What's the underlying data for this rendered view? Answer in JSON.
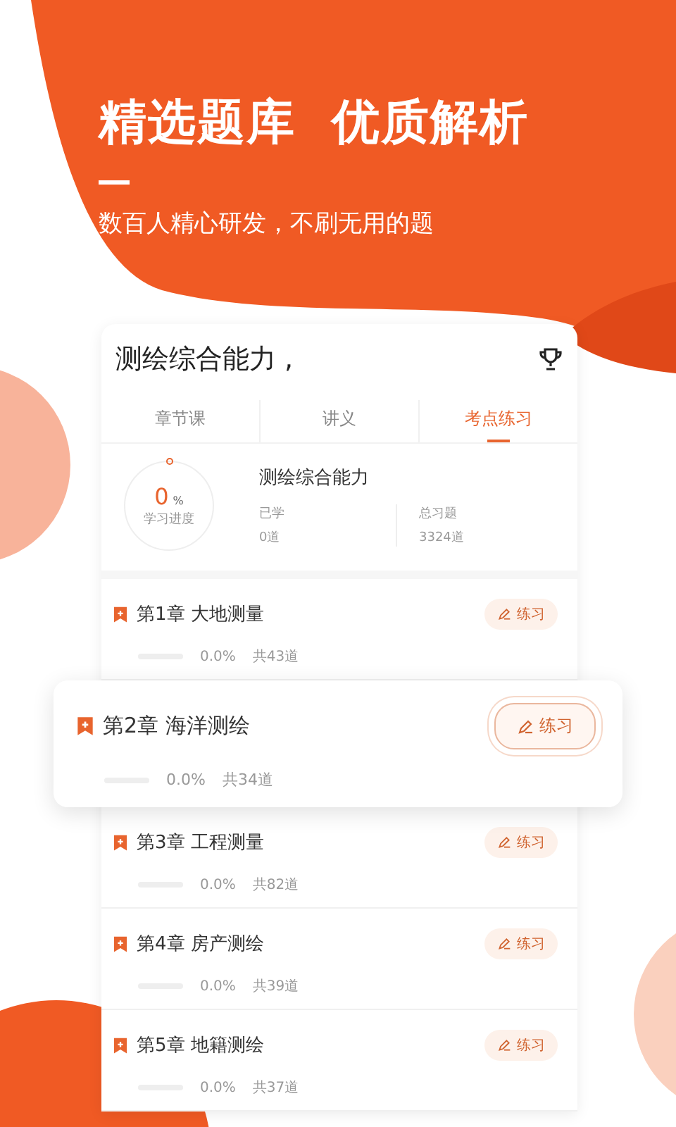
{
  "hero": {
    "title": "精选题库  优质解析",
    "subtitle": "数百人精心研发，不刷无用的题"
  },
  "card": {
    "title": "测绘综合能力 ,",
    "tabs": [
      {
        "label": "章节课",
        "selected": false
      },
      {
        "label": "讲义",
        "selected": false
      },
      {
        "label": "考点练习",
        "selected": true
      }
    ],
    "summary": {
      "percent": "0",
      "unit": "%",
      "progress_label": "学习进度",
      "name": "测绘综合能力",
      "learned_label": "已学",
      "learned": "0道",
      "total_label": "总习题",
      "total": "3324道"
    },
    "chapters": [
      {
        "title": "第1章 大地测量",
        "percent": "0.0%",
        "count": "共43道",
        "button": "练习",
        "highlighted": false
      },
      {
        "title": "第2章 海洋测绘",
        "percent": "0.0%",
        "count": "共34道",
        "button": "练习",
        "highlighted": true
      },
      {
        "title": "第3章 工程测量",
        "percent": "0.0%",
        "count": "共82道",
        "button": "练习",
        "highlighted": false
      },
      {
        "title": "第4章 房产测绘",
        "percent": "0.0%",
        "count": "共39道",
        "button": "练习",
        "highlighted": false
      },
      {
        "title": "第5章 地籍测绘",
        "percent": "0.0%",
        "count": "共37道",
        "button": "练习",
        "highlighted": false
      }
    ]
  }
}
